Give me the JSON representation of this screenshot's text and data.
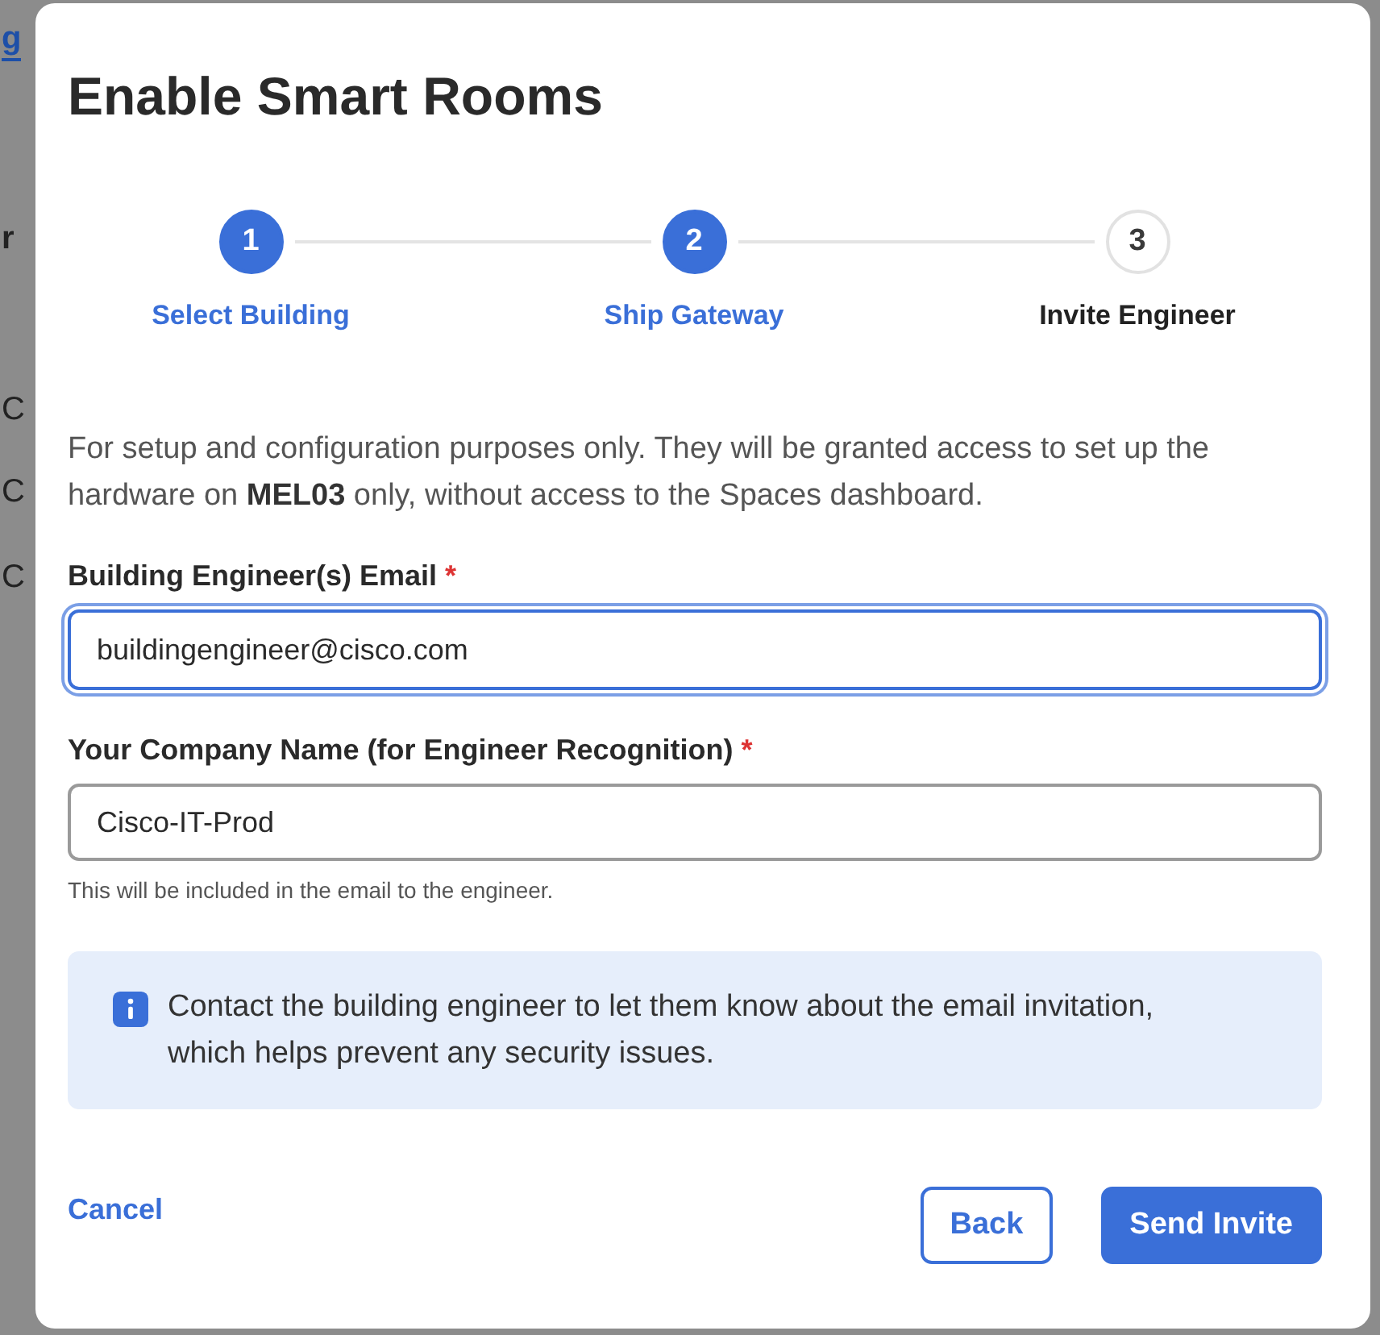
{
  "backdrop": {
    "fragments": [
      {
        "text": "g",
        "kind": "link"
      },
      {
        "text": "r",
        "kind": "heading"
      },
      {
        "text": "C",
        "kind": "text"
      },
      {
        "text": "C",
        "kind": "text"
      },
      {
        "text": "C",
        "kind": "text"
      }
    ]
  },
  "dialog": {
    "title": "Enable Smart Rooms",
    "steps": [
      {
        "number": "1",
        "label": "Select Building",
        "completed": true
      },
      {
        "number": "2",
        "label": "Ship Gateway",
        "completed": true
      },
      {
        "number": "3",
        "label": "Invite Engineer",
        "completed": false
      }
    ],
    "description": "For setup and configuration purposes only. They will be granted access to set up the hardware on **MEL03** only, without access to the Spaces dashboard.",
    "fields": [
      {
        "label": "Building Engineer(s) Email",
        "required_mark": "*",
        "value": "buildingengineer@cisco.com",
        "focused": true
      },
      {
        "label": "Your Company Name (for Engineer Recognition)",
        "required_mark": "*",
        "value": "Cisco-IT-Prod",
        "focused": false,
        "help": "This will be included in the email to the engineer."
      }
    ],
    "notice": "Contact the building engineer to let them know about the email invitation, which helps prevent any security issues.",
    "cancel": "Cancel",
    "buttons": [
      {
        "label": "Back",
        "kind": "secondary"
      },
      {
        "label": "Send Invite",
        "kind": "primary"
      }
    ]
  }
}
